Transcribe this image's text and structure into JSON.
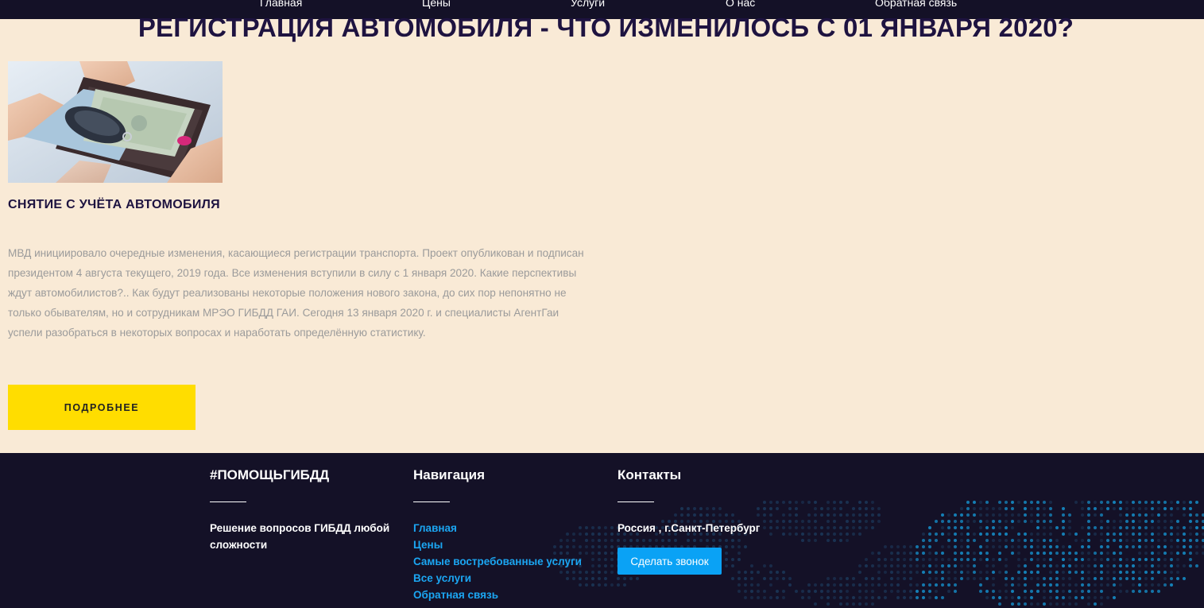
{
  "nav": {
    "items": [
      {
        "label": "Главная"
      },
      {
        "label": "Цены"
      },
      {
        "label": "Услуги"
      },
      {
        "label": "О нас"
      },
      {
        "label": "Обратная связь"
      }
    ]
  },
  "article": {
    "title": "РЕГИСТРАЦИЯ АВТОМОБИЛЯ - ЧТО ИЗМЕНИЛОСЬ С 01 ЯНВАРЯ 2020?",
    "subtitle": "СНЯТИЕ С УЧЁТА АВТОМОБИЛЯ",
    "body": "МВД инициировало очередные изменения, касающиеся регистрации транспорта. Проект опубликован и подписан президентом 4 августа текущего, 2019 года. Все изменения вступили в силу с 1 января 2020. Какие перспективы ждут автомобилистов?.. Как будут реализованы некоторые положения нового закона, до сих пор непонятно не только обывателям, но и сотрудникам МРЭО ГИБДД ГАИ. Сегодня 13 января 2020 г. и специалисты АгентГаи успели разобраться в некоторых вопросах и наработать определённую статистику.",
    "more_label": "ПОДРОБНЕЕ"
  },
  "footer": {
    "about": {
      "heading": "#ПОМОЩЬГИБДД",
      "text": "Решение вопросов ГИБДД любой сложности"
    },
    "navigation": {
      "heading": "Навигация",
      "links": [
        {
          "label": "Главная"
        },
        {
          "label": "Цены"
        },
        {
          "label": "Самые востребованные услуги"
        },
        {
          "label": "Все услуги"
        },
        {
          "label": "Обратная связь"
        }
      ]
    },
    "contacts": {
      "heading": "Контакты",
      "address": "Россия , г.Санкт-Петербург",
      "call_label": "Сделать звонок"
    }
  },
  "colors": {
    "page_background": "#f9ead6",
    "dark_navy": "#141127",
    "title_text": "#1e1340",
    "body_text": "#9b9b9b",
    "button_yellow": "#ffdd00",
    "link_blue": "#1ba6f2",
    "call_button_blue": "#0aa2f5"
  }
}
